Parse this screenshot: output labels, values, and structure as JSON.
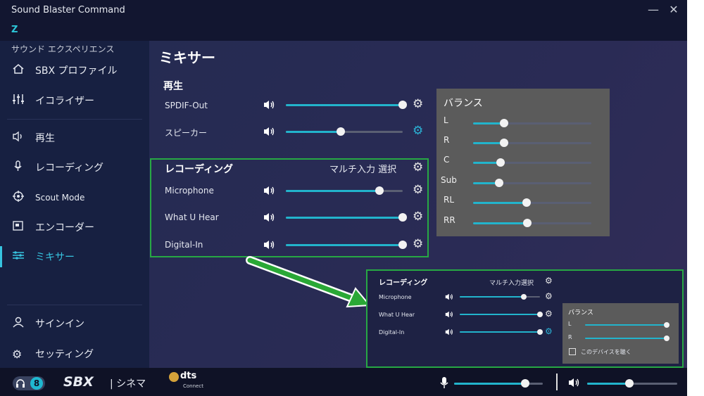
{
  "window": {
    "title": "Sound Blaster Command",
    "device": "Z",
    "minimize": "—",
    "close": "✕"
  },
  "sidebar": {
    "header": "サウンド エクスペリエンス",
    "items": [
      {
        "label": "SBX プロファイル",
        "icon": "home-icon"
      },
      {
        "label": "イコライザー",
        "icon": "equalizer-icon"
      },
      {
        "label": "再生",
        "icon": "speaker-icon"
      },
      {
        "label": "レコーディング",
        "icon": "microphone-icon"
      },
      {
        "label": "Scout Mode",
        "icon": "crosshair-icon"
      },
      {
        "label": "エンコーダー",
        "icon": "encoder-icon"
      },
      {
        "label": "ミキサー",
        "icon": "mixer-icon"
      },
      {
        "label": "サインイン",
        "icon": "user-icon"
      },
      {
        "label": "セッティング",
        "icon": "gear-icon"
      }
    ]
  },
  "main": {
    "title": "ミキサー",
    "playback": {
      "title": "再生",
      "rows": [
        {
          "label": "SPDIF-Out",
          "level": 1.0
        },
        {
          "label": "スピーカー",
          "level": 0.47
        }
      ]
    },
    "recording": {
      "title": "レコーディング",
      "multi_input": "マルチ入力 選択",
      "rows": [
        {
          "label": "Microphone",
          "level": 0.8
        },
        {
          "label": "What U Hear",
          "level": 1.0
        },
        {
          "label": "Digital-In",
          "level": 1.0
        }
      ]
    },
    "balance": {
      "title": "バランス",
      "channels": [
        {
          "label": "L",
          "level": 0.26
        },
        {
          "label": "R",
          "level": 0.26
        },
        {
          "label": "C",
          "level": 0.23
        },
        {
          "label": "Sub",
          "level": 0.22
        },
        {
          "label": "RL",
          "level": 0.45
        },
        {
          "label": "RR",
          "level": 0.46
        }
      ]
    }
  },
  "inset": {
    "title": "レコーディング",
    "multi_input": "マルチ入力選択",
    "rows": [
      {
        "label": "Microphone",
        "level": 0.8
      },
      {
        "label": "What U Hear",
        "level": 1.0
      },
      {
        "label": "Digital-In",
        "level": 1.0
      }
    ],
    "balance": {
      "title": "バランス",
      "channels": [
        {
          "label": "L",
          "level": 1.0
        },
        {
          "label": "R",
          "level": 1.0
        }
      ],
      "listen_label": "このデバイスを聴く",
      "listen_checked": false
    }
  },
  "bottom": {
    "headphone_badge": "8",
    "sbx_logo": "SBX",
    "sbx_mode": "| シネマ",
    "dts_logo": "dts",
    "dts_sub": "Connect",
    "mic_level": 0.8,
    "speaker_level": 0.47
  },
  "colors": {
    "accent": "#22b4cc",
    "highlight": "#27a844",
    "panel": "#5b5b5b"
  }
}
